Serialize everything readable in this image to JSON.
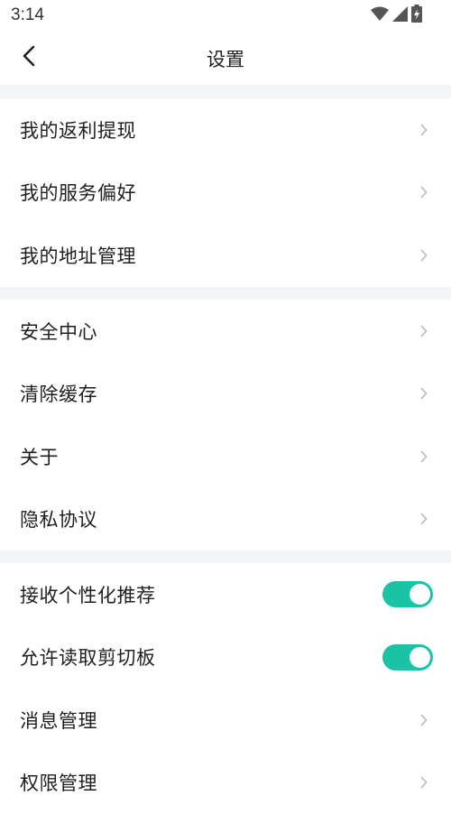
{
  "status_bar": {
    "time": "3:14",
    "icons": [
      "wifi-icon",
      "cell-signal-icon",
      "battery-charging-icon"
    ]
  },
  "header": {
    "title": "设置",
    "back_icon": "chevron-left-icon"
  },
  "groups": [
    {
      "items": [
        {
          "label": "我的返利提现",
          "control": "chevron"
        },
        {
          "label": "我的服务偏好",
          "control": "chevron"
        },
        {
          "label": "我的地址管理",
          "control": "chevron"
        }
      ]
    },
    {
      "items": [
        {
          "label": "安全中心",
          "control": "chevron"
        },
        {
          "label": "清除缓存",
          "control": "chevron"
        },
        {
          "label": "关于",
          "control": "chevron"
        },
        {
          "label": "隐私协议",
          "control": "chevron"
        }
      ]
    },
    {
      "items": [
        {
          "label": "接收个性化推荐",
          "control": "toggle",
          "on": true
        },
        {
          "label": "允许读取剪切板",
          "control": "toggle",
          "on": true
        },
        {
          "label": "消息管理",
          "control": "chevron"
        },
        {
          "label": "权限管理",
          "control": "chevron"
        }
      ]
    }
  ],
  "colors": {
    "accent": "#19c3a6",
    "divider": "#f4f5f7",
    "chevron": "#b8b8b8"
  }
}
